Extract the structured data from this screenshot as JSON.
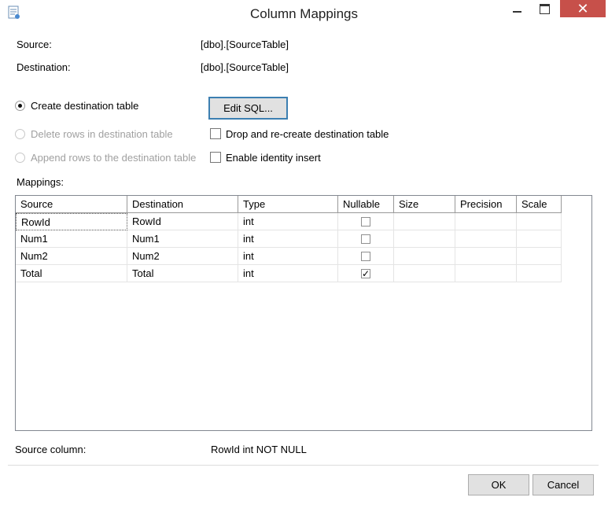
{
  "window": {
    "title": "Column Mappings",
    "close_glyph": "✕"
  },
  "info": {
    "source_label": "Source:",
    "source_value": "[dbo].[SourceTable]",
    "destination_label": "Destination:",
    "destination_value": "[dbo].[SourceTable]"
  },
  "options": {
    "create_label": "Create destination table",
    "create_selected": true,
    "delete_label": "Delete rows in destination table",
    "append_label": "Append rows to the destination table",
    "edit_sql_label": "Edit SQL...",
    "drop_recreate_label": "Drop and re-create destination table",
    "drop_recreate_checked": false,
    "identity_insert_label": "Enable identity insert",
    "identity_insert_checked": false
  },
  "mappings": {
    "label": "Mappings:",
    "columns": [
      "Source",
      "Destination",
      "Type",
      "Nullable",
      "Size",
      "Precision",
      "Scale"
    ],
    "rows": [
      {
        "source": "RowId",
        "destination": "RowId",
        "type": "int",
        "nullable": false,
        "size": "",
        "precision": "",
        "scale": ""
      },
      {
        "source": "Num1",
        "destination": "Num1",
        "type": "int",
        "nullable": false,
        "size": "",
        "precision": "",
        "scale": ""
      },
      {
        "source": "Num2",
        "destination": "Num2",
        "type": "int",
        "nullable": false,
        "size": "",
        "precision": "",
        "scale": ""
      },
      {
        "source": "Total",
        "destination": "Total",
        "type": "int",
        "nullable": true,
        "size": "",
        "precision": "",
        "scale": ""
      }
    ]
  },
  "status": {
    "label": "Source column:",
    "value": "RowId int NOT NULL"
  },
  "buttons": {
    "ok": "OK",
    "cancel": "Cancel"
  }
}
